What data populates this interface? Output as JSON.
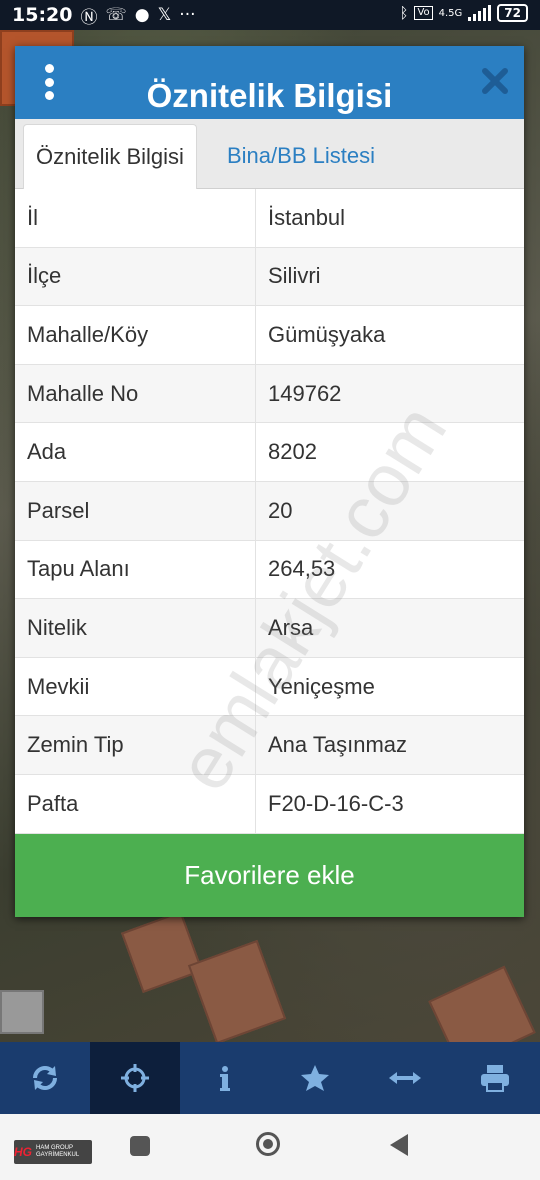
{
  "status_bar": {
    "time": "15:20",
    "network_type": "4.5G",
    "battery": "72",
    "icons": [
      "nfc-icon",
      "missed-call-icon",
      "chat-icon",
      "x-app-icon",
      "more-dots-icon",
      "bluetooth-icon",
      "volte-icon",
      "signal-icon",
      "battery-icon"
    ]
  },
  "dialog": {
    "title": "Öznitelik Bilgisi",
    "tabs": [
      {
        "label": "Öznitelik Bilgisi",
        "active": true
      },
      {
        "label": "Bina/BB Listesi",
        "active": false
      }
    ],
    "rows": [
      {
        "key": "İl",
        "value": "İstanbul"
      },
      {
        "key": "İlçe",
        "value": "Silivri"
      },
      {
        "key": "Mahalle/Köy",
        "value": "Gümüşyaka"
      },
      {
        "key": "Mahalle No",
        "value": "149762"
      },
      {
        "key": "Ada",
        "value": "8202"
      },
      {
        "key": "Parsel",
        "value": "20"
      },
      {
        "key": "Tapu Alanı",
        "value": "264,53"
      },
      {
        "key": "Nitelik",
        "value": "Arsa"
      },
      {
        "key": "Mevkii",
        "value": "Yeniçeşme"
      },
      {
        "key": "Zemin Tip",
        "value": "Ana Taşınmaz"
      },
      {
        "key": "Pafta",
        "value": "F20-D-16-C-3"
      }
    ],
    "favorite_button": "Favorilere ekle"
  },
  "watermark": "emlakjet.com",
  "toolbar": {
    "items": [
      "refresh-icon",
      "locate-icon",
      "info-icon",
      "star-icon",
      "measure-icon",
      "print-icon"
    ],
    "active": "info-icon"
  },
  "nav_bar": {
    "logo_text": "HAM GROUP GAYRİMENKUL",
    "logo_mark": "HG"
  },
  "colors": {
    "header_blue": "#2b7fc2",
    "favorite_green": "#4caf50",
    "toolbar_blue": "#1a3c6e"
  }
}
